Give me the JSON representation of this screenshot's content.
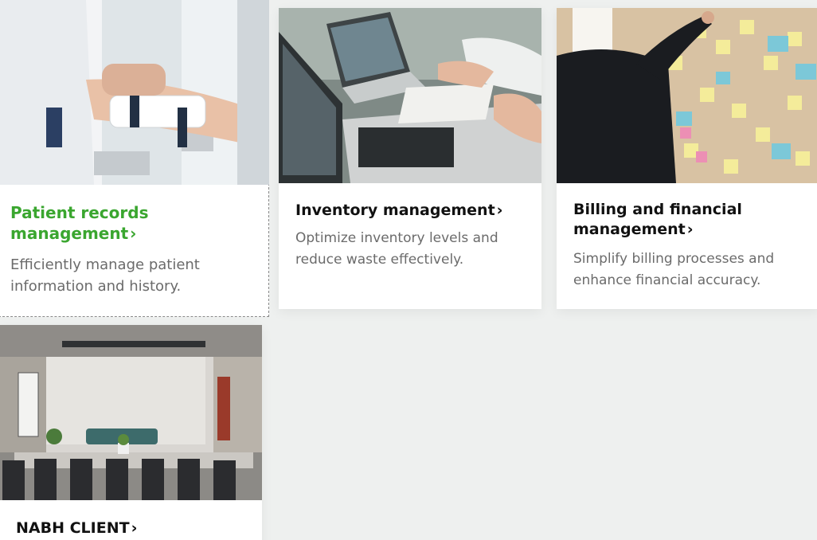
{
  "cards": [
    {
      "title": "Patient records management",
      "chevron": "›",
      "description": "Efficiently manage patient information and history.",
      "image_icon": "doctor-patient-wrist-photo"
    },
    {
      "title": "Inventory management",
      "chevron": "›",
      "description": "Optimize inventory levels and reduce waste effectively.",
      "image_icon": "laptop-notes-photo"
    },
    {
      "title": "Billing and financial management",
      "chevron": "›",
      "description": "Simplify billing processes and enhance financial accuracy.",
      "image_icon": "sticky-notes-board-photo"
    },
    {
      "title": "NABH CLIENT",
      "chevron": "›",
      "description": "",
      "image_icon": "office-meeting-room-photo"
    }
  ],
  "colors": {
    "background": "#eef0ef",
    "active_title": "#3aa62f",
    "title": "#111111",
    "description": "#6b6b6b"
  }
}
